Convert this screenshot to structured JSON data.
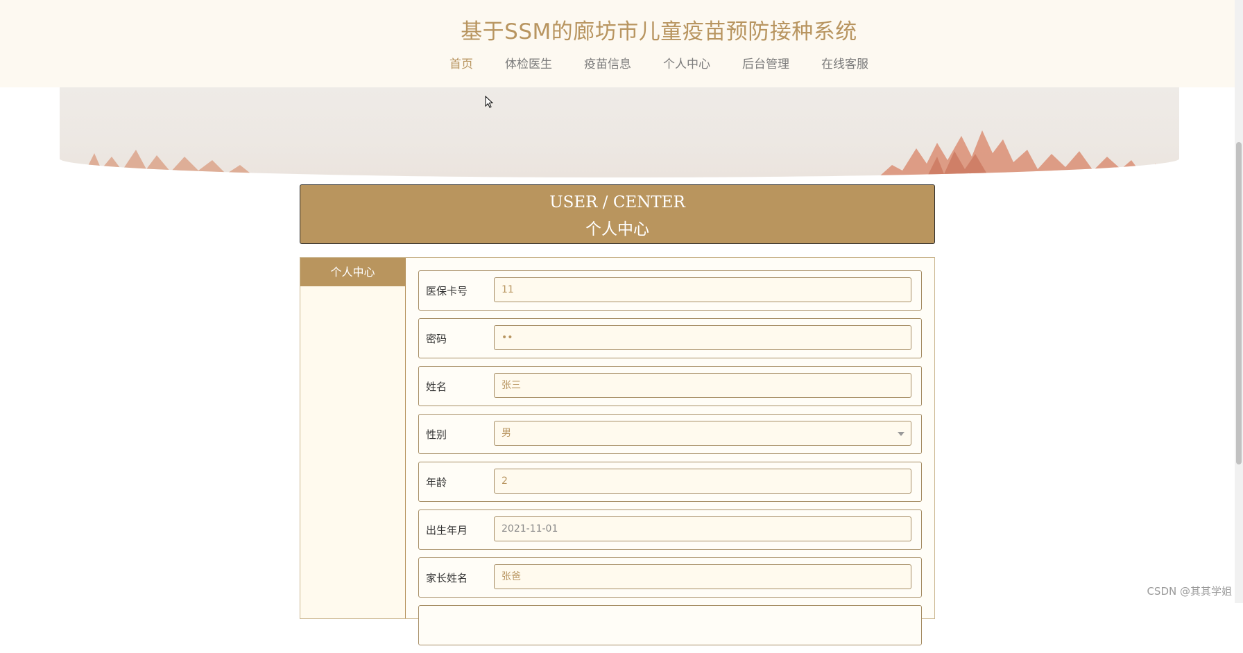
{
  "header": {
    "title": "基于SSM的廊坊市儿童疫苗预防接种系统",
    "nav": [
      "首页",
      "体检医生",
      "疫苗信息",
      "个人中心",
      "后台管理",
      "在线客服"
    ],
    "active_index": 0
  },
  "banner": {
    "image": "autumn-trees-illustration"
  },
  "center": {
    "title_en": "USER / CENTER",
    "title_cn": "个人中心"
  },
  "sidebar": {
    "items": [
      "个人中心"
    ]
  },
  "form": {
    "fields": [
      {
        "label": "医保卡号",
        "value": "11"
      },
      {
        "label": "密码",
        "value": "••"
      },
      {
        "label": "姓名",
        "value": "张三"
      },
      {
        "label": "性别",
        "value": "男"
      },
      {
        "label": "年龄",
        "value": "2"
      },
      {
        "label": "出生年月",
        "value": "2021-11-01"
      },
      {
        "label": "家长姓名",
        "value": "张爸"
      }
    ]
  },
  "watermark": "CSDN @其其学姐",
  "colors": {
    "accent": "#b9955e",
    "header_bg": "#fdf9f1",
    "panel_bg": "#fffdf7"
  }
}
